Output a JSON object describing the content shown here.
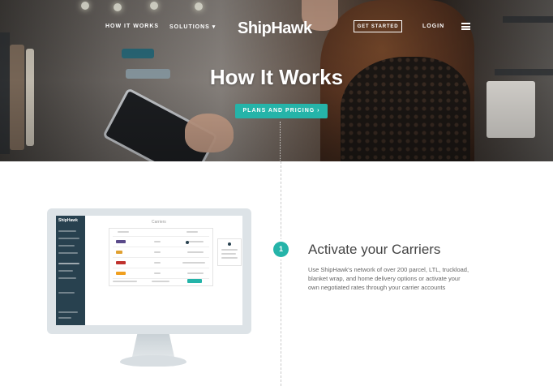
{
  "nav": {
    "how_it_works": "HOW IT WORKS",
    "solutions": "SOLUTIONS",
    "solutions_caret": "▾",
    "logo": "ShipHawk",
    "get_started": "GET STARTED",
    "login": "LOGIN",
    "menu_icon": "hamburger-menu-icon"
  },
  "hero": {
    "title": "How It Works",
    "cta": "PLANS AND PRICING ›"
  },
  "step": {
    "number": "1",
    "title": "Activate your Carriers",
    "description": "Use ShipHawk's network of over 200 parcel, LTL, truckload, blanket wrap, and home delivery options or activate your own negotiated rates through your carrier accounts"
  },
  "monitor": {
    "app_logo": "ShipHawk",
    "page_title": "Carriers"
  },
  "colors": {
    "accent": "#25b4a9",
    "sidebar": "#28414f"
  }
}
